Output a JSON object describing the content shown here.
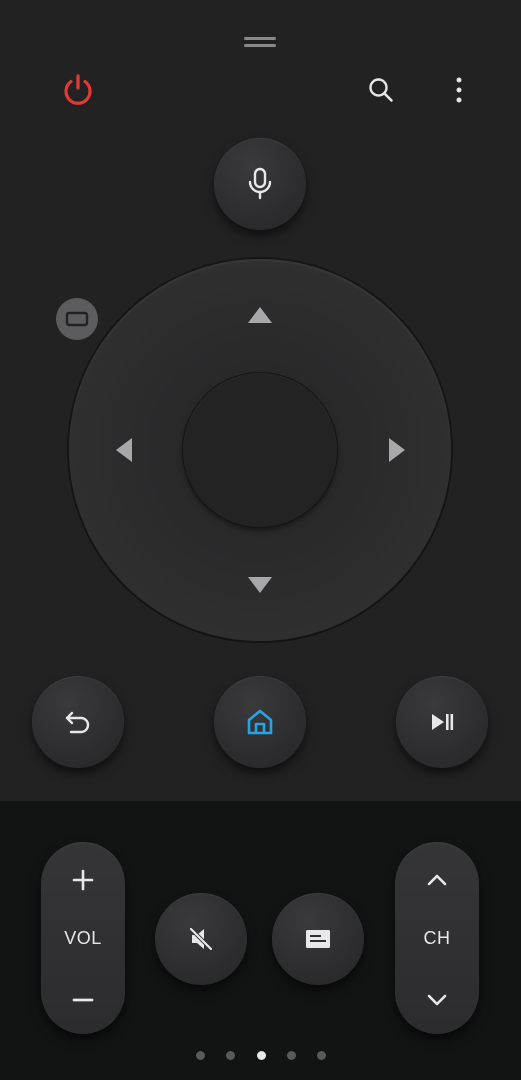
{
  "top_bar": {
    "power_icon": "power-icon",
    "search_icon": "search-icon",
    "more_icon": "more-vertical-icon",
    "power_color": "#e53935"
  },
  "buttons": {
    "mic_icon": "microphone-icon",
    "input_icon": "input-source-icon",
    "back_icon": "back-icon",
    "home_icon": "home-icon",
    "home_color": "#29a3e6",
    "play_pause_icon": "play-pause-icon",
    "mute_icon": "mute-icon",
    "guide_icon": "guide-icon"
  },
  "dpad": {
    "up_icon": "arrow-up-icon",
    "down_icon": "arrow-down-icon",
    "left_icon": "arrow-left-icon",
    "right_icon": "arrow-right-icon"
  },
  "volume": {
    "label": "VOL",
    "up_icon": "plus-icon",
    "down_icon": "minus-icon"
  },
  "channel": {
    "label": "CH",
    "up_icon": "chevron-up-icon",
    "down_icon": "chevron-down-icon"
  },
  "pager": {
    "page_count": 5,
    "active_page": 3
  }
}
